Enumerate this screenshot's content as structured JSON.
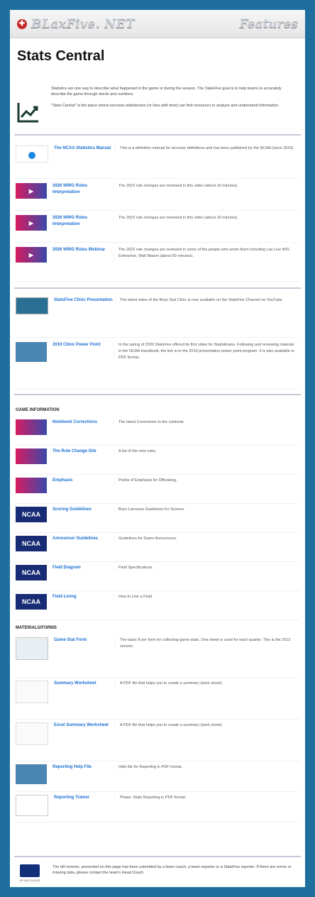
{
  "header": {
    "site_name": "BLaxFive. NET",
    "section": "Features"
  },
  "page": {
    "title": "Stats Central",
    "intro_p1": "Statistics are one way to describe what happened in the game or during the season. The StatsFive goal is to help teams to accurately describe the game through words and numbers.",
    "intro_p2": "\"Stats Central\" is the place where lacrosse statisticians (or fans with time) can find resources to analyze and understand information."
  },
  "resources_a": [
    {
      "thumb": "book",
      "link": "The NCAA Statistics Manual",
      "desc": "This is a definitive manual for lacrosse definitions and has been published by the NCAA (since 2023)."
    },
    {
      "thumb": "wiki",
      "link": "2026 WWG Rules Interpretation",
      "desc": "The 2023 rule changes are reviewed in this video (about 10 minutes)."
    },
    {
      "thumb": "wiki",
      "link": "2026 WWG Rules Interpretation",
      "desc": "The 2023 rule changes are reviewed in this video (about 10 minutes)."
    },
    {
      "thumb": "wiki",
      "link": "2026 WWG Rules Webinar",
      "desc": "The 2023 rule changes are reviewed in some of the people who wrote them including Lax Live WIS Enterprise, Walt Mason (about 50 minutes)."
    }
  ],
  "resources_b": [
    {
      "thumb": "photo",
      "link": "StatsFive Clinic Presentation",
      "desc": "The latest video of the Boys Stat Clinic is now available on the StatsFive Channel on YouTube."
    },
    {
      "thumb": "photo2",
      "link": "2019 Clinic Power Point",
      "desc": "In the spring of 2020 StatsFive offered its first video for Statisticians. Following and reviewing material in the NCAA Handbook, the link is to the 2019 presentation power point program. It is also available in PDF format."
    }
  ],
  "game_info": {
    "heading": "GAME INFORMATION",
    "items": [
      {
        "thumb": "wiki",
        "link": "Notebook Corrections",
        "desc": "The latest Corrections to the rulebook."
      },
      {
        "thumb": "wiki",
        "link": "The Rule Change Site",
        "desc": "A list of the new rules."
      },
      {
        "thumb": "wiki",
        "link": "Emphasis",
        "desc": "Points of Emphasis for Officiating."
      },
      {
        "thumb": "ncaa",
        "link": "Scoring Guidelines",
        "desc": "Boys Lacrosse Guidelines for Scorers."
      },
      {
        "thumb": "ncaa",
        "link": "Announcer Guidelines",
        "desc": "Guidelines for Game Announcers."
      },
      {
        "thumb": "ncaa",
        "link": "Field Diagram",
        "desc": "Field Specifications."
      },
      {
        "thumb": "ncaa",
        "link": "Field Lining",
        "desc": "How to Line a Field."
      }
    ]
  },
  "materials": {
    "heading": "MATERIALS/FORMS",
    "items": [
      {
        "thumb": "paper",
        "link": "Game Stat Form",
        "desc": "The basic 8 per form for collecting game stats. One sheet is used for each quarter. This is the 2013 version."
      },
      {
        "thumb": "paper2",
        "link": "Summary Worksheet",
        "desc": "A PDF file that helps you to create a summary (work sheet)."
      },
      {
        "thumb": "paper2",
        "link": "Excel Summary Worksheet",
        "desc": "A PDF file that helps you to create a summary (work sheet)."
      },
      {
        "thumb": "photo2",
        "link": "Reporting Help File",
        "desc": "Help file for Reporting in PDF format."
      },
      {
        "thumb": "doc",
        "link": "Reporting Trainer",
        "desc": "Phase: Stats Reporting in PDF format."
      }
    ]
  },
  "footer": {
    "badge_caption": "AP ID# 13-0109",
    "text": "The bill reverse, presented on this page has been submitted by a team coach, a team reporter or a StatsFive reporter. If there are errors or missing data, please contact the team's Head Coach."
  }
}
